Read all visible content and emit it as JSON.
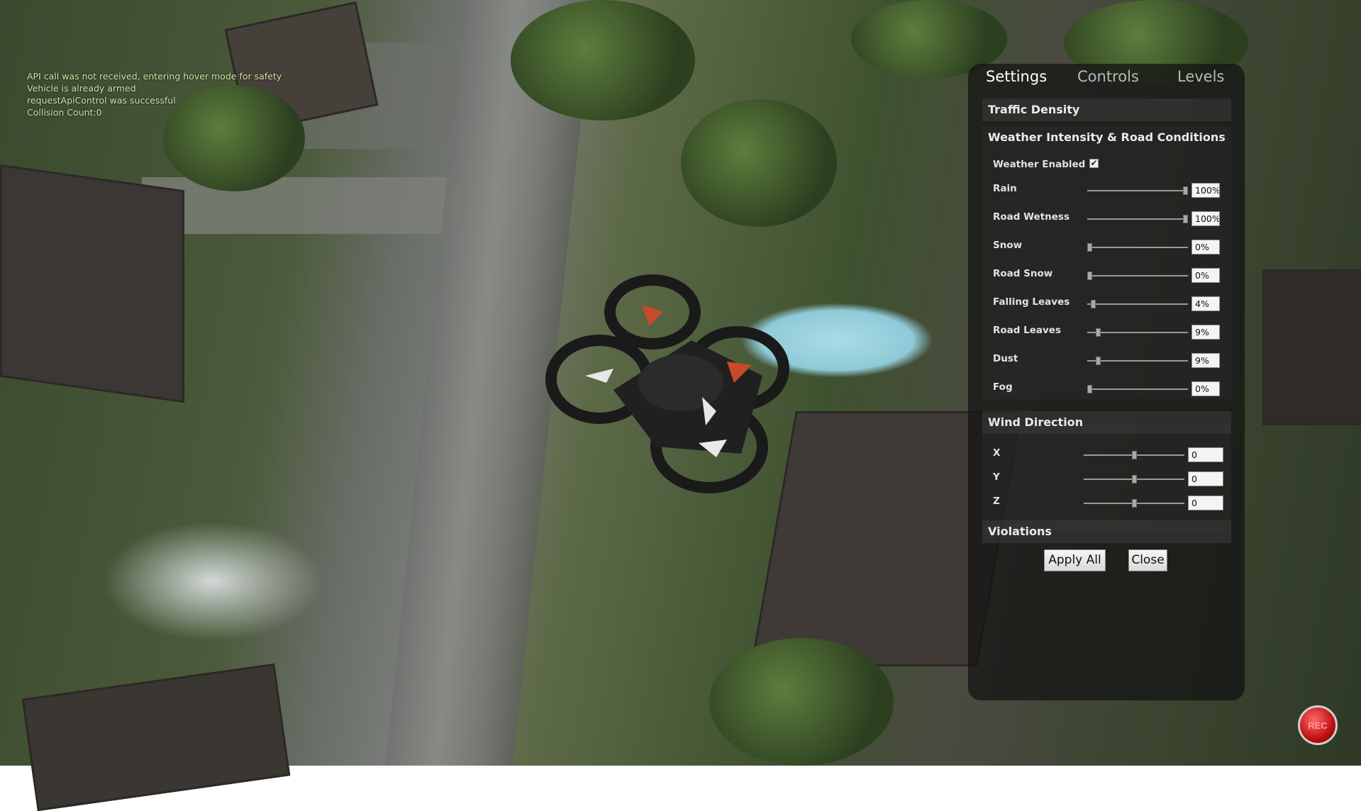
{
  "hud_log": [
    "API call was not received, entering hover mode for safety",
    "Vehicle is already armed",
    "requestApiControl was successful",
    "Collision Count:0"
  ],
  "tabs": [
    "Settings",
    "Controls",
    "Levels"
  ],
  "active_tab": "Settings",
  "sections": {
    "traffic": "Traffic Density",
    "weather": "Weather Intensity & Road Conditions",
    "wind": "Wind Direction",
    "violations": "Violations"
  },
  "weather_enabled": {
    "label": "Weather Enabled",
    "checked": true,
    "mark": "✔"
  },
  "weather_sliders": [
    {
      "label": "Rain",
      "value_text": "100%",
      "value": 1.0
    },
    {
      "label": "Road Wetness",
      "value_text": "100%",
      "value": 1.0
    },
    {
      "label": "Snow",
      "value_text": "0%",
      "value": 0.0
    },
    {
      "label": "Road Snow",
      "value_text": "0%",
      "value": 0.0
    },
    {
      "label": "Falling Leaves",
      "value_text": "4%",
      "value": 0.04
    },
    {
      "label": "Road Leaves",
      "value_text": "9%",
      "value": 0.09
    },
    {
      "label": "Dust",
      "value_text": "9%",
      "value": 0.09
    },
    {
      "label": "Fog",
      "value_text": "0%",
      "value": 0.0
    }
  ],
  "wind_sliders": [
    {
      "label": "X",
      "value_text": "0",
      "value": 0.5
    },
    {
      "label": "Y",
      "value_text": "0",
      "value": 0.5
    },
    {
      "label": "Z",
      "value_text": "0",
      "value": 0.5
    }
  ],
  "buttons": {
    "apply": "Apply All",
    "close": "Close"
  },
  "record_button": {
    "label": "REC",
    "icon": "record-icon",
    "color": "#c01010"
  },
  "colors": {
    "panel_bg": "#121212",
    "hud_text": "#d6e6a8"
  }
}
